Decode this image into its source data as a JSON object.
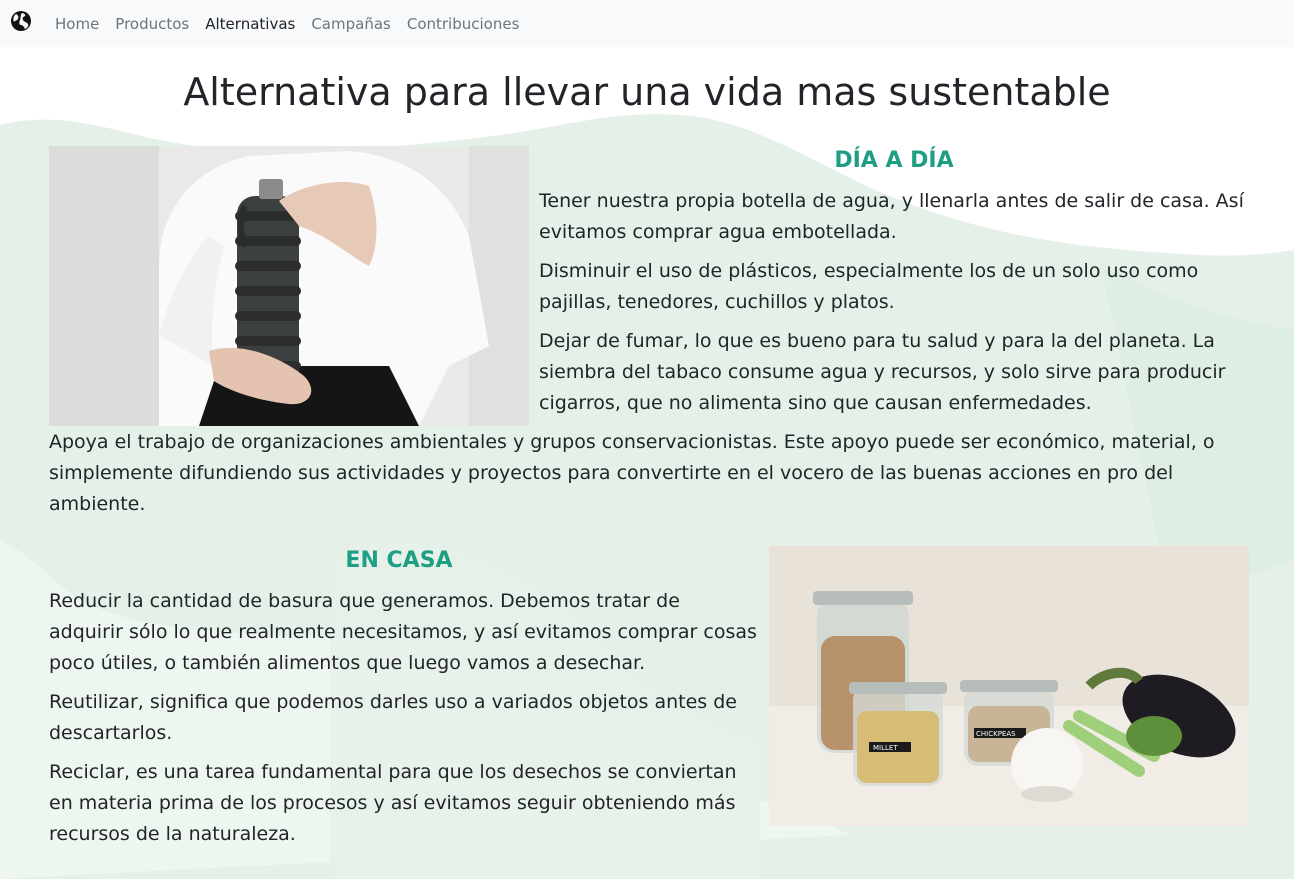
{
  "nav": {
    "brand_icon": "globe-icon",
    "links": [
      {
        "label": "Home",
        "active": false
      },
      {
        "label": "Productos",
        "active": false
      },
      {
        "label": "Alternativas",
        "active": true
      },
      {
        "label": "Campañas",
        "active": false
      },
      {
        "label": "Contribuciones",
        "active": false
      }
    ]
  },
  "page": {
    "title": "Alternativa para llevar una vida mas sustentable"
  },
  "dia_a_dia": {
    "title": "DÍA A DÍA",
    "image": "collapsible-water-bottle-photo",
    "paragraphs": [
      "Tener nuestra propia botella de agua, y llenarla antes de salir de casa. Así evitamos comprar agua embotellada.",
      "Disminuir el uso de plásticos, especialmente los de un solo uso como pajillas, tenedores, cuchillos y platos.",
      "Dejar de fumar, lo que es bueno para tu salud y para la del planeta. La siembra del tabaco consume agua y recursos, y solo sirve para producir cigarros, que no alimenta sino que causan enfermedades.",
      "Apoya el trabajo de organizaciones ambientales y grupos conservacionistas. Este apoyo puede ser económico, material, o simplemente difundiendo sus actividades y proyectos para convertirte en el vocero de las buenas acciones en pro del ambiente."
    ]
  },
  "en_casa": {
    "title": "EN CASA",
    "image": "glass-jars-and-vegetables-photo",
    "jar_labels": [
      "MILLET",
      "CHICKPEAS"
    ],
    "paragraphs": [
      "Reducir la cantidad de basura que generamos. Debemos tratar de adquirir sólo lo que realmente necesitamos, y así evitamos comprar cosas poco útiles, o también alimentos que luego vamos a desechar.",
      "Reutilizar, significa que podemos darles uso a variados objetos antes de descartarlos.",
      "Reciclar, es una tarea fundamental para que los desechos se conviertan en materia prima de los procesos y así evitamos seguir obteniendo más recursos de la naturaleza."
    ]
  },
  "colors": {
    "accent": "#1f9e86",
    "navbar_bg": "#f8f9fa",
    "wave_bg": "#e3f0e8"
  }
}
